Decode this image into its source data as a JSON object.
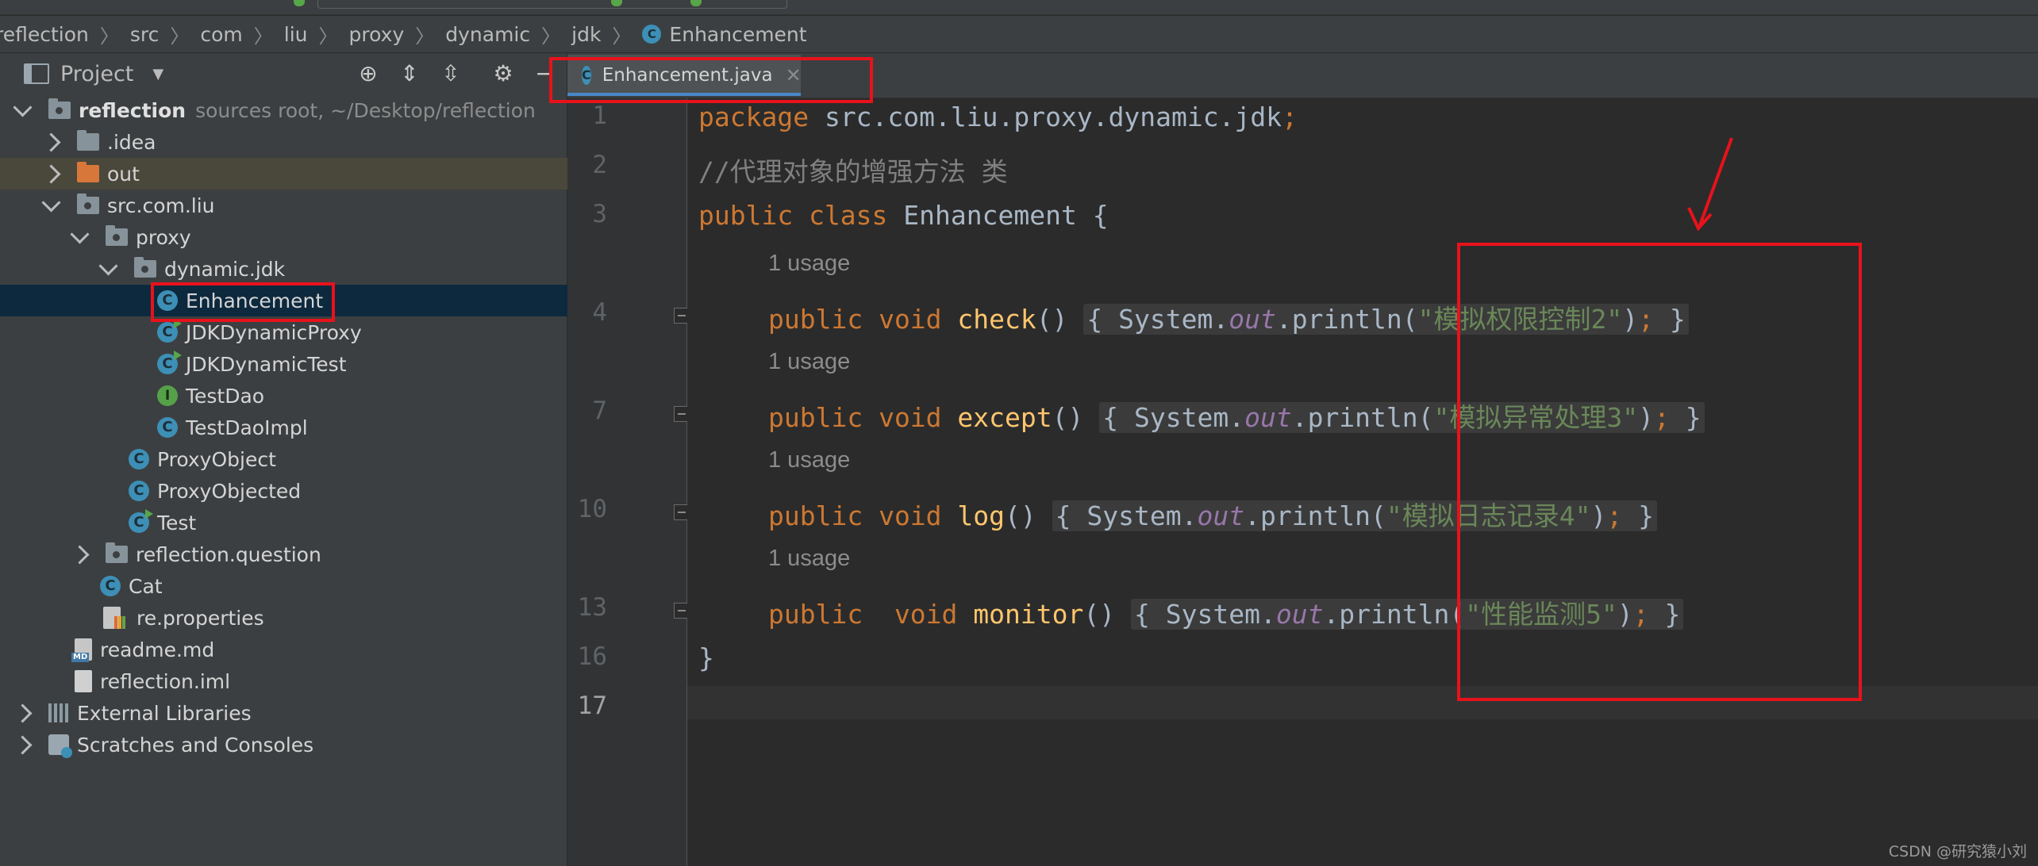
{
  "breadcrumb": [
    "reflection",
    "src",
    "com",
    "liu",
    "proxy",
    "dynamic",
    "jdk",
    "Enhancement"
  ],
  "project_panel": {
    "title": "Project",
    "tree": [
      {
        "label": "reflection",
        "note": "sources root, ~/Desktop/reflection"
      },
      {
        "label": ".idea"
      },
      {
        "label": "out"
      },
      {
        "label": "src.com.liu"
      },
      {
        "label": "proxy"
      },
      {
        "label": "dynamic.jdk"
      },
      {
        "label": "Enhancement"
      },
      {
        "label": "JDKDynamicProxy"
      },
      {
        "label": "JDKDynamicTest"
      },
      {
        "label": "TestDao"
      },
      {
        "label": "TestDaoImpl"
      },
      {
        "label": "ProxyObject"
      },
      {
        "label": "ProxyObjected"
      },
      {
        "label": "Test"
      },
      {
        "label": "reflection.question"
      },
      {
        "label": "Cat"
      },
      {
        "label": "re.properties"
      },
      {
        "label": "readme.md"
      },
      {
        "label": "reflection.iml"
      },
      {
        "label": "External Libraries"
      },
      {
        "label": "Scratches and Consoles"
      }
    ]
  },
  "editor": {
    "tab_label": "Enhancement.java",
    "usage_hint": "1 usage",
    "line_numbers": [
      "1",
      "2",
      "3",
      "4",
      "7",
      "10",
      "13",
      "16",
      "17"
    ],
    "code": {
      "l1_kw": "package",
      "l1_rest": " src.com.liu.proxy.dynamic.jdk",
      "l1_semi": ";",
      "l2_comment": "//代理对象的增强方法 类",
      "l3_kw": "public class",
      "l3_rest": " Enhancement {",
      "kw_public_void": "public void",
      "kw_public_void_wide": "public  void",
      "m1": "check",
      "m2": "except",
      "m3": "log",
      "m4": "monitor",
      "parens": "()",
      "open": "{",
      "close": "}",
      "sys": "System.",
      "out": "out",
      "println": ".println(",
      "s1": "\"模拟权限控制2\"",
      "s2": "\"模拟异常处理3\"",
      "s3": "\"模拟日志记录4\"",
      "s4": "\"性能监测5\"",
      "rparen": ")",
      "semi": ";",
      "end_brace": "}"
    }
  },
  "watermark": "CSDN @研究猿小刘",
  "icons": {
    "class": "C",
    "interface": "I",
    "md_badge": "MD"
  },
  "colors": {
    "annotation_red": "#e8121b",
    "keyword": "#cc7832",
    "method": "#ffc66d",
    "string": "#6a8759",
    "field": "#9876aa"
  }
}
